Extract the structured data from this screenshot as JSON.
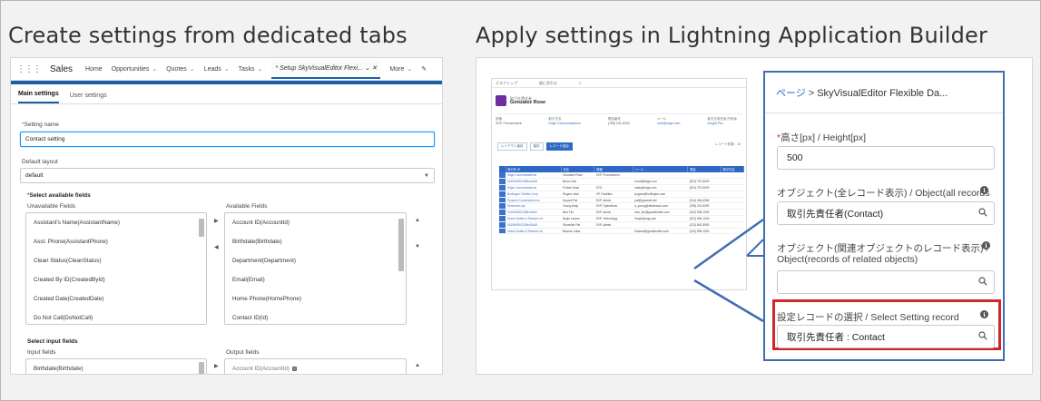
{
  "headings": {
    "left": "Create settings from dedicated tabs",
    "right": "Apply settings in Lightning Application Builder"
  },
  "left_panel": {
    "app_grid_icon": "app-launcher-icon",
    "app_name": "Sales",
    "nav": [
      {
        "label": "Home",
        "chevron": false
      },
      {
        "label": "Opportunities",
        "chevron": true
      },
      {
        "label": "Quotes",
        "chevron": true
      },
      {
        "label": "Leads",
        "chevron": true
      },
      {
        "label": "Tasks",
        "chevron": true
      }
    ],
    "active_tab": "* Setup SkyVisualEditor Flexi...",
    "more": "More",
    "subtabs": {
      "main": "Main settings",
      "user": "User settings"
    },
    "setting_name_label": "Setting name",
    "setting_name_value": "Contact setting",
    "default_layout_label": "Default layout",
    "default_layout_value": "default",
    "select_available_fields": "Select available fields",
    "unavailable_fields_label": "Unavailable Fields",
    "available_fields_label": "Available Fields",
    "unavailable_fields": [
      "Assistant's Name(AssistantName)",
      "Asst. Phone(AssistantPhone)",
      "Clean Status(CleanStatus)",
      "Created By ID(CreatedById)",
      "Created Date(CreatedDate)",
      "Do Not Call(DoNotCall)"
    ],
    "available_fields": [
      "Account ID(AccountId)",
      "Birthdate(Birthdate)",
      "Department(Department)",
      "Email(Email)",
      "Home Phone(HomePhone)",
      "Contact ID(Id)"
    ],
    "select_input_fields": "Select input fields",
    "input_fields_label": "Input fields",
    "output_fields_label": "Output fields",
    "input_field_first": "Birthdate(Birthdate)",
    "output_field_first": "Account ID(AccountId)"
  },
  "right_panel": {
    "mini": {
      "toolbar": [
        "デスクトップ",
        "縦に合わせ",
        "C"
      ],
      "record_type": "取引先責任者",
      "record_name": "Gonzalez Rose",
      "info": [
        {
          "label": "役職",
          "value": "SVP, Procurement"
        },
        {
          "label": "取引先名",
          "value": "Edge Communications"
        },
        {
          "label": "電話番号",
          "value": "(785) 241-6200"
        },
        {
          "label": "メール",
          "value": "rose@edge.com"
        },
        {
          "label": "取引先責任者 所有者",
          "value": "Insight Pla..."
        }
      ],
      "buttons": [
        {
          "label": "レイアウト保存",
          "on": false
        },
        {
          "label": "保存",
          "on": false
        },
        {
          "label": "レコード追加",
          "on": true
        }
      ],
      "count_text": "レコード件数：10",
      "headers": [
        "",
        "取引先 ID",
        "会社",
        "氏名",
        "役職",
        "電話",
        "メール",
        "所有者名",
        "取引先名"
      ],
      "rows": [
        [
          "",
          "Edge Communications",
          "Gonzalez Rose",
          "SVP, Procurement",
          "",
          "",
          ""
        ],
        [
          "",
          "0015h000012BkxxAAB",
          "Bond John",
          "",
          "bond@edge.com",
          "(512) 757-6000",
          ""
        ],
        [
          "",
          "Edge Communications",
          "Forbes Sean",
          "CFO",
          "sean@edge.com",
          "(512) 757-6000",
          ""
        ],
        [
          "",
          "Burlington Textiles Corp",
          "Rogers Jack",
          "VP, Facilities",
          "jrogers@burlington.com",
          "",
          ""
        ],
        [
          "",
          "Pyramid Construction Inc.",
          "Dupont Pat",
          "SVP, Admin",
          "pat@pyramid.net",
          "(014) 454-6364",
          ""
        ],
        [
          "",
          "Dickenson plc",
          "Young Andy",
          "SVP, Operations",
          "a_young@dickenson.com",
          "(785) 241-6200",
          ""
        ],
        [
          "",
          "0015h000012Bkx9AAC",
          "Barr Tim",
          "SVP, Admin",
          "barr_tim@grandhotels.com",
          "(312) 596-1000",
          ""
        ],
        [
          "",
          "Grand Hotels & Resorts Ltd",
          "Boyle Lauren",
          "SVP, Technology",
          "lboyle@uog.com",
          "(312) 596-1000",
          ""
        ],
        [
          "",
          "0015h000012Bkx9AAD",
          "Stumuller Pat",
          "SVP, Admin",
          "",
          "(212) 842-5500",
          ""
        ],
        [
          "",
          "Grand Hotels & Resorts Ltd",
          "Braund Linda",
          "",
          "lbraund@grandhotels.com",
          "(312) 596-1000",
          ""
        ]
      ]
    },
    "breadcrumb_home": "ページ",
    "breadcrumb_sep": ">",
    "breadcrumb_current": "SkyVisualEditor Flexible Da...",
    "height_label": "高さ[px] / Height[px]",
    "height_value": "500",
    "object_all_label": "オブジェクト(全レコード表示) / Object(all records",
    "object_all_value": "取引先責任者(Contact)",
    "object_related_label_line1": "オブジェクト(関連オブジェクトのレコード表示) /",
    "object_related_label_line2": "Object(records of related objects)",
    "object_related_value": "",
    "setting_record_label": "設定レコードの選択 / Select Setting record",
    "setting_record_value": "取引先責任者 : Contact",
    "colors": {
      "accent_blue": "#3f6eb3",
      "highlight_red": "#d0252b"
    }
  }
}
